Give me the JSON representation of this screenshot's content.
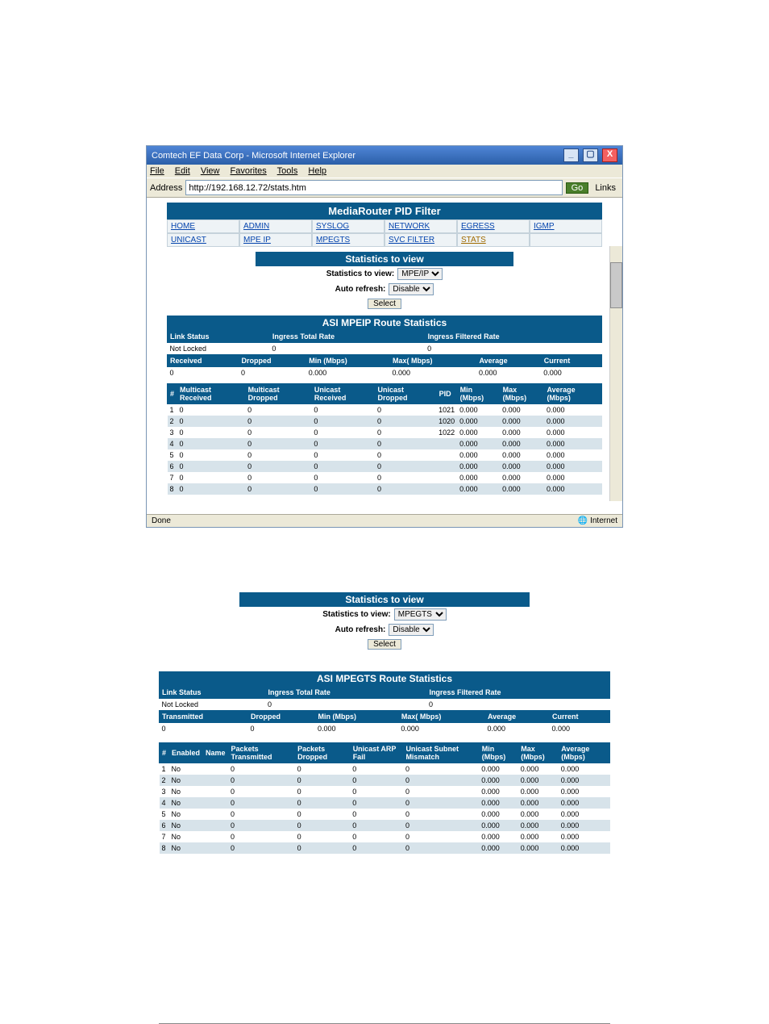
{
  "browser": {
    "window_title": "Comtech EF Data Corp - Microsoft Internet Explorer",
    "menu": [
      "File",
      "Edit",
      "View",
      "Favorites",
      "Tools",
      "Help"
    ],
    "address_label": "Address",
    "address_url": "http://192.168.12.72/stats.htm",
    "go_label": "Go",
    "links_label": "Links",
    "status_left": "Done",
    "status_right": "Internet"
  },
  "app": {
    "header_title": "MediaRouter PID Filter",
    "nav_row1": [
      "HOME",
      "ADMIN",
      "SYSLOG",
      "NETWORK",
      "EGRESS",
      "IGMP"
    ],
    "nav_row2": [
      "UNICAST",
      "MPE IP",
      "MPEGTS",
      "SVC FILTER",
      "STATS",
      ""
    ]
  },
  "selector1": {
    "title": "Statistics to view",
    "label_stats": "Statistics to view:",
    "value_stats": "MPE/IP",
    "label_refresh": "Auto refresh:",
    "value_refresh": "Disable",
    "button": "Select"
  },
  "mpeip": {
    "title": "ASI MPEIP Route Statistics",
    "t1_headers": [
      "Link Status",
      "Ingress Total Rate",
      "Ingress Filtered Rate"
    ],
    "t1_values": [
      "Not Locked",
      "0",
      "0"
    ],
    "t2_headers": [
      "Received",
      "Dropped",
      "Min (Mbps)",
      "Max( Mbps)",
      "Average",
      "Current"
    ],
    "t2_values": [
      "0",
      "0",
      "0.000",
      "0.000",
      "0.000",
      "0.000"
    ],
    "t3_headers": [
      "#",
      "Multicast Received",
      "Multicast Dropped",
      "Unicast Received",
      "Unicast Dropped",
      "PID",
      "Min (Mbps)",
      "Max (Mbps)",
      "Average (Mbps)"
    ],
    "t3_rows": [
      [
        "1",
        "0",
        "0",
        "0",
        "0",
        "1021",
        "0.000",
        "0.000",
        "0.000"
      ],
      [
        "2",
        "0",
        "0",
        "0",
        "0",
        "1020",
        "0.000",
        "0.000",
        "0.000"
      ],
      [
        "3",
        "0",
        "0",
        "0",
        "0",
        "1022",
        "0.000",
        "0.000",
        "0.000"
      ],
      [
        "4",
        "0",
        "0",
        "0",
        "0",
        "",
        "0.000",
        "0.000",
        "0.000"
      ],
      [
        "5",
        "0",
        "0",
        "0",
        "0",
        "",
        "0.000",
        "0.000",
        "0.000"
      ],
      [
        "6",
        "0",
        "0",
        "0",
        "0",
        "",
        "0.000",
        "0.000",
        "0.000"
      ],
      [
        "7",
        "0",
        "0",
        "0",
        "0",
        "",
        "0.000",
        "0.000",
        "0.000"
      ],
      [
        "8",
        "0",
        "0",
        "0",
        "0",
        "",
        "0.000",
        "0.000",
        "0.000"
      ]
    ]
  },
  "selector2": {
    "title": "Statistics to view",
    "label_stats": "Statistics to view:",
    "value_stats": "MPEGTS",
    "label_refresh": "Auto refresh:",
    "value_refresh": "Disable",
    "button": "Select"
  },
  "mpegts": {
    "title": "ASI MPEGTS Route Statistics",
    "t1_headers": [
      "Link Status",
      "Ingress Total Rate",
      "Ingress Filtered Rate"
    ],
    "t1_values": [
      "Not Locked",
      "0",
      "0"
    ],
    "t2_headers": [
      "Transmitted",
      "Dropped",
      "Min (Mbps)",
      "Max( Mbps)",
      "Average",
      "Current"
    ],
    "t2_values": [
      "0",
      "0",
      "0.000",
      "0.000",
      "0.000",
      "0.000"
    ],
    "t3_headers": [
      "#",
      "Enabled",
      "Name",
      "Packets Transmitted",
      "Packets Dropped",
      "Unicast ARP Fail",
      "Unicast Subnet Mismatch",
      "Min (Mbps)",
      "Max (Mbps)",
      "Average (Mbps)"
    ],
    "t3_rows": [
      [
        "1",
        "No",
        "",
        "0",
        "0",
        "0",
        "0",
        "0.000",
        "0.000",
        "0.000"
      ],
      [
        "2",
        "No",
        "",
        "0",
        "0",
        "0",
        "0",
        "0.000",
        "0.000",
        "0.000"
      ],
      [
        "3",
        "No",
        "",
        "0",
        "0",
        "0",
        "0",
        "0.000",
        "0.000",
        "0.000"
      ],
      [
        "4",
        "No",
        "",
        "0",
        "0",
        "0",
        "0",
        "0.000",
        "0.000",
        "0.000"
      ],
      [
        "5",
        "No",
        "",
        "0",
        "0",
        "0",
        "0",
        "0.000",
        "0.000",
        "0.000"
      ],
      [
        "6",
        "No",
        "",
        "0",
        "0",
        "0",
        "0",
        "0.000",
        "0.000",
        "0.000"
      ],
      [
        "7",
        "No",
        "",
        "0",
        "0",
        "0",
        "0",
        "0.000",
        "0.000",
        "0.000"
      ],
      [
        "8",
        "No",
        "",
        "0",
        "0",
        "0",
        "0",
        "0.000",
        "0.000",
        "0.000"
      ]
    ]
  }
}
